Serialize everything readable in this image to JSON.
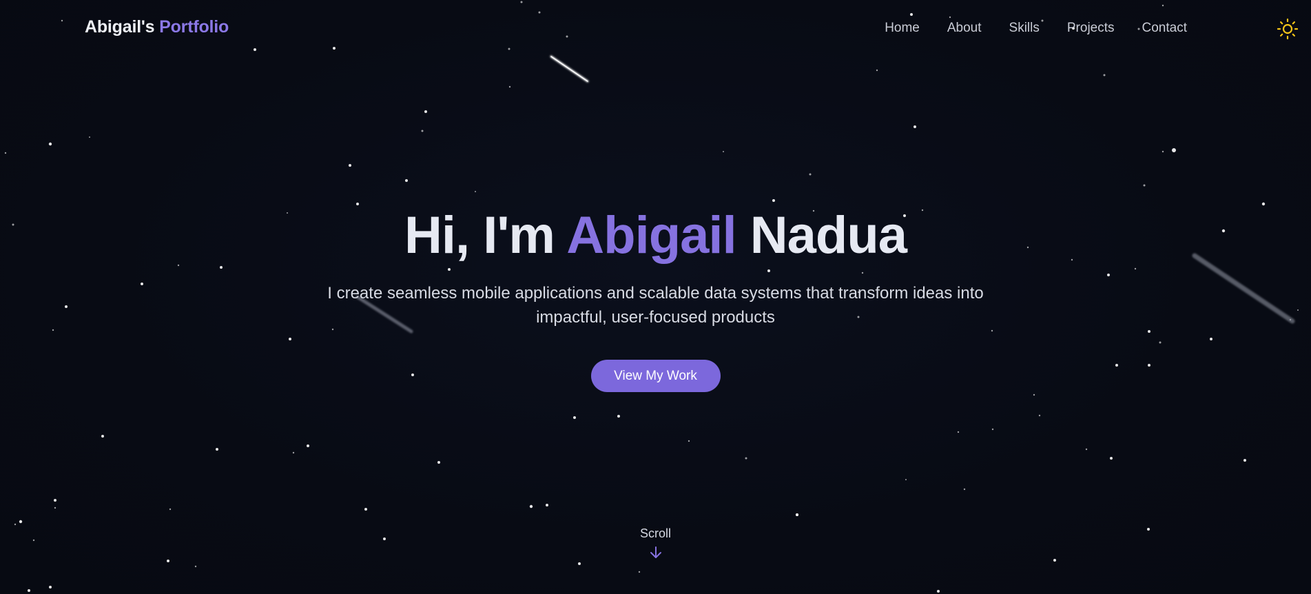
{
  "brand": {
    "name": "Abigail's",
    "accent": "Portfolio"
  },
  "nav": {
    "items": [
      {
        "label": "Home"
      },
      {
        "label": "About"
      },
      {
        "label": "Skills"
      },
      {
        "label": "Projects"
      },
      {
        "label": "Contact"
      }
    ],
    "theme_toggle_icon": "sun-icon"
  },
  "hero": {
    "greeting": "Hi, I'm",
    "first_name": "Abigail",
    "last_name": "Nadua",
    "subtitle": "I create seamless mobile applications and scalable data systems that transform ideas into impactful, user-focused products",
    "cta_label": "View My Work"
  },
  "scroll": {
    "label": "Scroll",
    "icon": "arrow-down-icon"
  },
  "colors": {
    "background": "#080b14",
    "accent": "#8672e0",
    "button": "#7c68dc",
    "sun": "#f5c518"
  }
}
